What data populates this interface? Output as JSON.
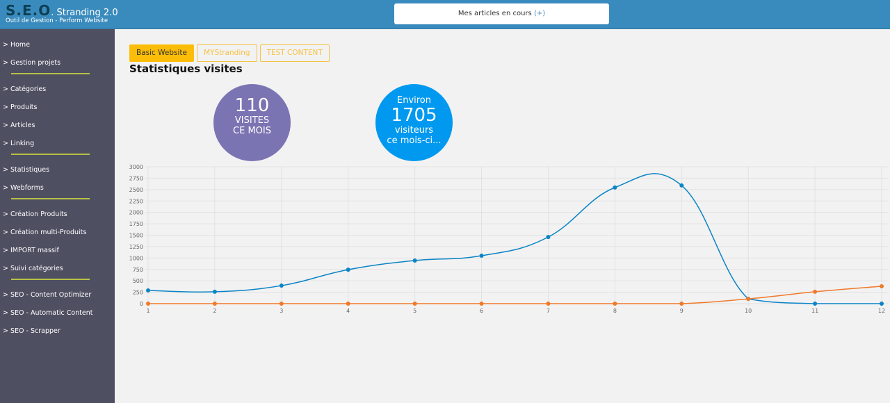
{
  "header": {
    "logo_seo": "S.E.O",
    "logo_rest": ". Stranding 2.0",
    "subtitle": "Outil de Gestion - Perform Website",
    "articles_label": "Mes articles en cours",
    "articles_plus": "(+)"
  },
  "sidebar": {
    "items": [
      "> Home",
      "> Gestion projets",
      "> Catégories",
      "> Produits",
      "> Articles",
      "> Linking",
      "> Statistiques",
      "> Webforms",
      "> Création Produits",
      "> Création multi-Produits",
      "> IMPORT massif",
      "> Suivi catégories",
      "> SEO - Content Optimizer",
      "> SEO - Automatic Content",
      "> SEO - Scrapper"
    ]
  },
  "tabs": [
    "Basic Website",
    "MYStranding",
    "TEST CONTENT"
  ],
  "title": "Statistiques visites",
  "stat1": {
    "value": "110",
    "line1": "VISITES",
    "line2": "CE MOIS",
    "color": "#7b74b3"
  },
  "stat2": {
    "prefix": "Environ",
    "value": "1705",
    "line1": "visiteurs",
    "line2": "ce mois-ci...",
    "color": "#0099ef"
  },
  "chart_data": {
    "type": "line",
    "categories": [
      "1",
      "2",
      "3",
      "4",
      "5",
      "6",
      "7",
      "8",
      "9",
      "10",
      "11",
      "12"
    ],
    "ylim": [
      0,
      3000
    ],
    "yticks": [
      0,
      250,
      500,
      750,
      1000,
      1250,
      1500,
      1750,
      2000,
      2250,
      2500,
      2750,
      3000
    ],
    "grid": true,
    "series": [
      {
        "color": "#0a84c6",
        "values": [
          290,
          260,
          395,
          745,
          945,
          1050,
          1460,
          2545,
          2590,
          105,
          0,
          0
        ]
      },
      {
        "color": "#f07a2a",
        "values": [
          0,
          0,
          0,
          0,
          0,
          0,
          0,
          0,
          0,
          105,
          260,
          380
        ]
      }
    ]
  }
}
